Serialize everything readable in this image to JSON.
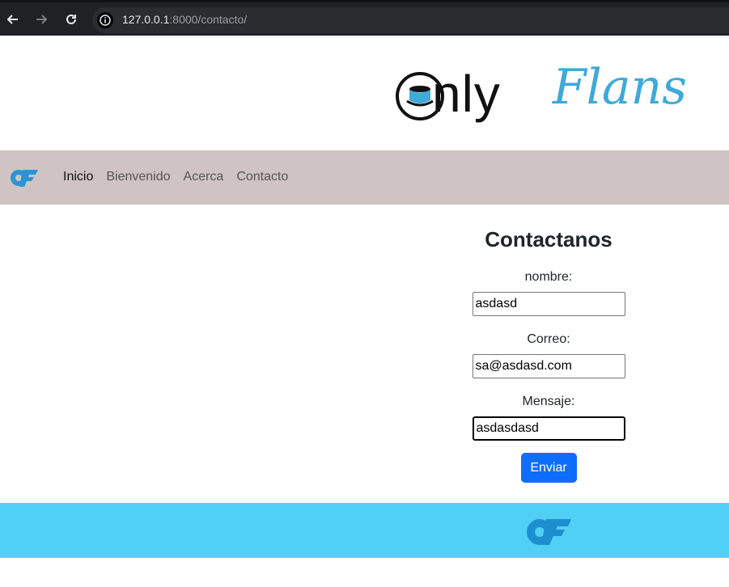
{
  "browser": {
    "url_host": "127.0.0.1",
    "url_path": ":8000/contacto/"
  },
  "logo": {
    "text_only": "nly",
    "text_flans": "Flans"
  },
  "navbar": {
    "items": [
      {
        "label": "Inicio",
        "active": true
      },
      {
        "label": "Bienvenido",
        "active": false
      },
      {
        "label": "Acerca",
        "active": false
      },
      {
        "label": "Contacto",
        "active": false
      }
    ]
  },
  "form": {
    "title": "Contactanos",
    "nombre_label": "nombre:",
    "nombre_value": "asdasd",
    "correo_label": "Correo:",
    "correo_value": "sa@asdasd.com",
    "mensaje_label": "Mensaje:",
    "mensaje_value": "asdasdasd",
    "submit_label": "Enviar"
  },
  "colors": {
    "navbar_bg": "#d0c3c3",
    "footer_bg": "#4fd0f4",
    "button_bg": "#0d6efd",
    "brand_blue": "#3fa9d8"
  }
}
